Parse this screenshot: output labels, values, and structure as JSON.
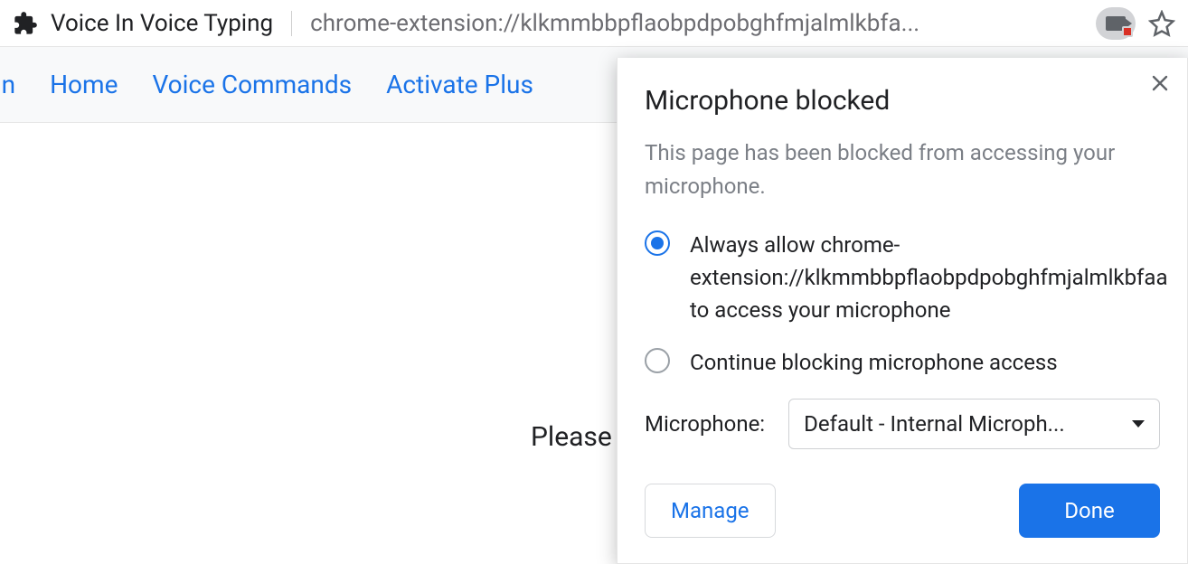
{
  "address_bar": {
    "title": "Voice In Voice Typing",
    "url": "chrome-extension://klkmmbbpflaobpdpobghfmjalmlkbfa..."
  },
  "nav": {
    "brand_fragment": "In",
    "links": [
      "Home",
      "Voice Commands",
      "Activate Plus"
    ]
  },
  "page": {
    "body_text": "Please gra"
  },
  "popover": {
    "title": "Microphone blocked",
    "description": "This page has been blocked from accessing your microphone.",
    "options": [
      {
        "label": "Always allow chrome-extension://klkmmbbpflaobpdpobghfmjalmlkbfaa to access your microphone",
        "selected": true
      },
      {
        "label": "Continue blocking microphone access",
        "selected": false
      }
    ],
    "mic_label": "Microphone:",
    "mic_selected": "Default - Internal Microph...",
    "manage_label": "Manage",
    "done_label": "Done"
  }
}
